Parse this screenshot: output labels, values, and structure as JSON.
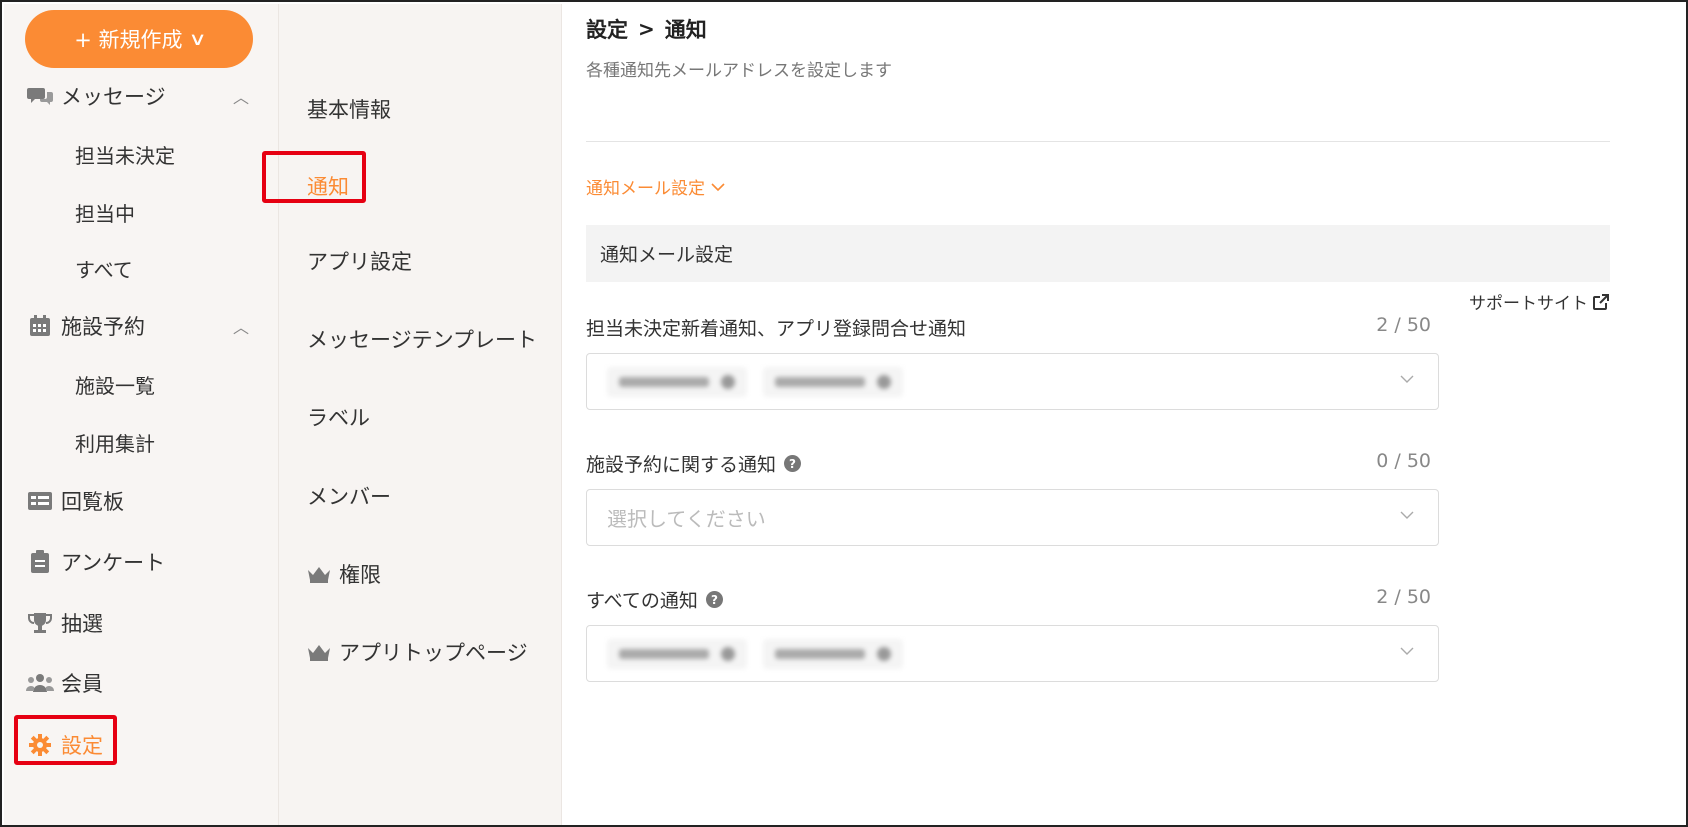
{
  "sidebar": {
    "new_button": "+ 新規作成",
    "items": [
      {
        "label": "メッセージ",
        "icon": "chat-icon"
      },
      {
        "label": "担当未決定"
      },
      {
        "label": "担当中"
      },
      {
        "label": "すべて"
      },
      {
        "label": "施設予約",
        "icon": "calendar-icon"
      },
      {
        "label": "施設一覧"
      },
      {
        "label": "利用集計"
      },
      {
        "label": "回覧板",
        "icon": "board-icon"
      },
      {
        "label": "アンケート",
        "icon": "clipboard-icon"
      },
      {
        "label": "抽選",
        "icon": "trophy-icon"
      },
      {
        "label": "会員",
        "icon": "users-icon"
      },
      {
        "label": "設定",
        "icon": "gear-icon"
      }
    ]
  },
  "submenu": {
    "items": [
      {
        "label": "基本情報"
      },
      {
        "label": "通知"
      },
      {
        "label": "アプリ設定"
      },
      {
        "label": "メッセージテンプレート"
      },
      {
        "label": "ラベル"
      },
      {
        "label": "メンバー"
      },
      {
        "label": "権限",
        "icon": "crown-icon"
      },
      {
        "label": "アプリトップページ",
        "icon": "crown-icon"
      }
    ]
  },
  "main": {
    "breadcrumb": {
      "parent": "設定",
      "separator": ">",
      "current": "通知"
    },
    "description": "各種通知先メールアドレスを設定します",
    "accordion_label": "通知メール設定",
    "section_title": "通知メール設定",
    "support_link": "サポートサイト",
    "fields": [
      {
        "label": "担当未決定新着通知、アプリ登録問合せ通知",
        "count": "2 / 50",
        "placeholder": "",
        "has_help": false
      },
      {
        "label": "施設予約に関する通知",
        "count": "0 / 50",
        "placeholder": "選択してください",
        "has_help": true
      },
      {
        "label": "すべての通知",
        "count": "2 / 50",
        "placeholder": "",
        "has_help": true
      }
    ]
  },
  "colors": {
    "accent": "#fb8b34",
    "highlight": "#e60012"
  }
}
